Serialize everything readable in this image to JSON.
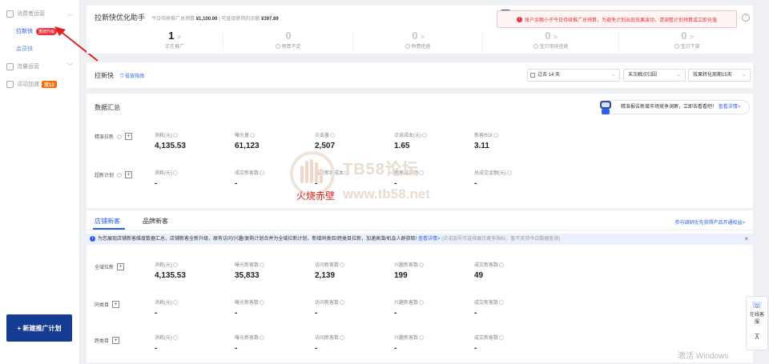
{
  "sidebar": {
    "group1": "消费者运营",
    "sub_active": "拉新快",
    "sub_active_badge": "重磅升级",
    "sub_plain": "会员快",
    "group2": "流量运营",
    "group3": "活动加速",
    "group3_badge": "双12",
    "new_plan": "+ 新建推广计划"
  },
  "top": {
    "title": "拉新快优化助手",
    "meta_label1": "今日待续推广总预算",
    "meta_value1": "¥1,100.00",
    "meta_sep": "| 可直接使用的余额",
    "meta_value2": "¥397.89",
    "alert": "账户余额小于今日待续推广总预算，为避免计划出现效果波动，请调整计划预算或立即充值",
    "stats": [
      {
        "num": "1",
        "label": "正在推广"
      },
      {
        "num": "0",
        "label": "预算不足"
      },
      {
        "num": "0",
        "label": "附费拒绝"
      },
      {
        "num": "0",
        "label": "宝贝审核拒绝"
      },
      {
        "num": "0",
        "label": "宝贝下架"
      }
    ]
  },
  "filter": {
    "title": "拉新快",
    "guide": "投放指南",
    "date": "过去 14 天",
    "click": "末次触点归因",
    "period": "效果转化周期15天"
  },
  "summary": {
    "title": "数据汇总",
    "report_text": "精准报告新增市场竞争洞察，立即去看看吧！",
    "report_link": "查看详情>",
    "rows": [
      {
        "label": "精准拉新",
        "metrics": [
          {
            "label": "消耗(元)",
            "value": "4,135.53"
          },
          {
            "label": "曝光量",
            "value": "61,123"
          },
          {
            "label": "点击量",
            "value": "2,507"
          },
          {
            "label": "点击成本(元)",
            "value": "1.65"
          },
          {
            "label": "新客ROI",
            "value": "3.11"
          }
        ]
      },
      {
        "label": "超新计划",
        "metrics": [
          {
            "label": "消耗(元)",
            "value": "-"
          },
          {
            "label": "成交新客数",
            "value": "-"
          },
          {
            "label": "成交新客成本",
            "value": "-"
          },
          {
            "label": "新客成交额",
            "value": "-"
          },
          {
            "label": "总成交金额(元)",
            "value": "-"
          }
        ]
      }
    ]
  },
  "brand": {
    "tab1": "店铺新客",
    "tab2": "品牌新客",
    "survey_link": "参与调研优先获得产品开通权益>",
    "notice": "为您展现店铺新客维度数据汇总，店铺新客全新升级，原有访问/兴趣/复购计划合并为全域拉新计划，新增同类目/跨类目拉新，加速高潜/机会人群获取!",
    "notice_link": "查看详情>",
    "notice_tail": "(点击加号可选择展示更多指标，暂不支持今日数据查询)",
    "rows": [
      {
        "label": "全域拉新",
        "metrics": [
          {
            "label": "消耗(元)",
            "value": "4,135.53"
          },
          {
            "label": "曝光新客数",
            "value": "35,833"
          },
          {
            "label": "访问新客数",
            "value": "2,139"
          },
          {
            "label": "兴趣新客数",
            "value": "199"
          },
          {
            "label": "成交新客数",
            "value": "49"
          }
        ]
      },
      {
        "label": "同类目",
        "metrics": [
          {
            "label": "消耗(元)",
            "value": "-"
          },
          {
            "label": "曝光新客数",
            "value": "-"
          },
          {
            "label": "访问新客数",
            "value": "-"
          },
          {
            "label": "兴趣新客数",
            "value": "-"
          },
          {
            "label": "成交新客数",
            "value": "-"
          }
        ]
      },
      {
        "label": "跨类目",
        "metrics": [
          {
            "label": "消耗(元)",
            "value": "-"
          },
          {
            "label": "曝光新客数",
            "value": "-"
          },
          {
            "label": "访问新客数",
            "value": "-"
          },
          {
            "label": "兴趣新客数",
            "value": "-"
          },
          {
            "label": "成交新客数",
            "value": "-"
          }
        ]
      }
    ]
  },
  "float": {
    "service": "在线客服"
  },
  "watermark": {
    "text": "TB58论坛",
    "url": "www.tb58.net",
    "red": "火烧赤壁",
    "windows": "激活 Windows"
  },
  "colors": {
    "accent": "#2e5fe6",
    "danger": "#e9313b",
    "nav_button": "#163c91"
  }
}
